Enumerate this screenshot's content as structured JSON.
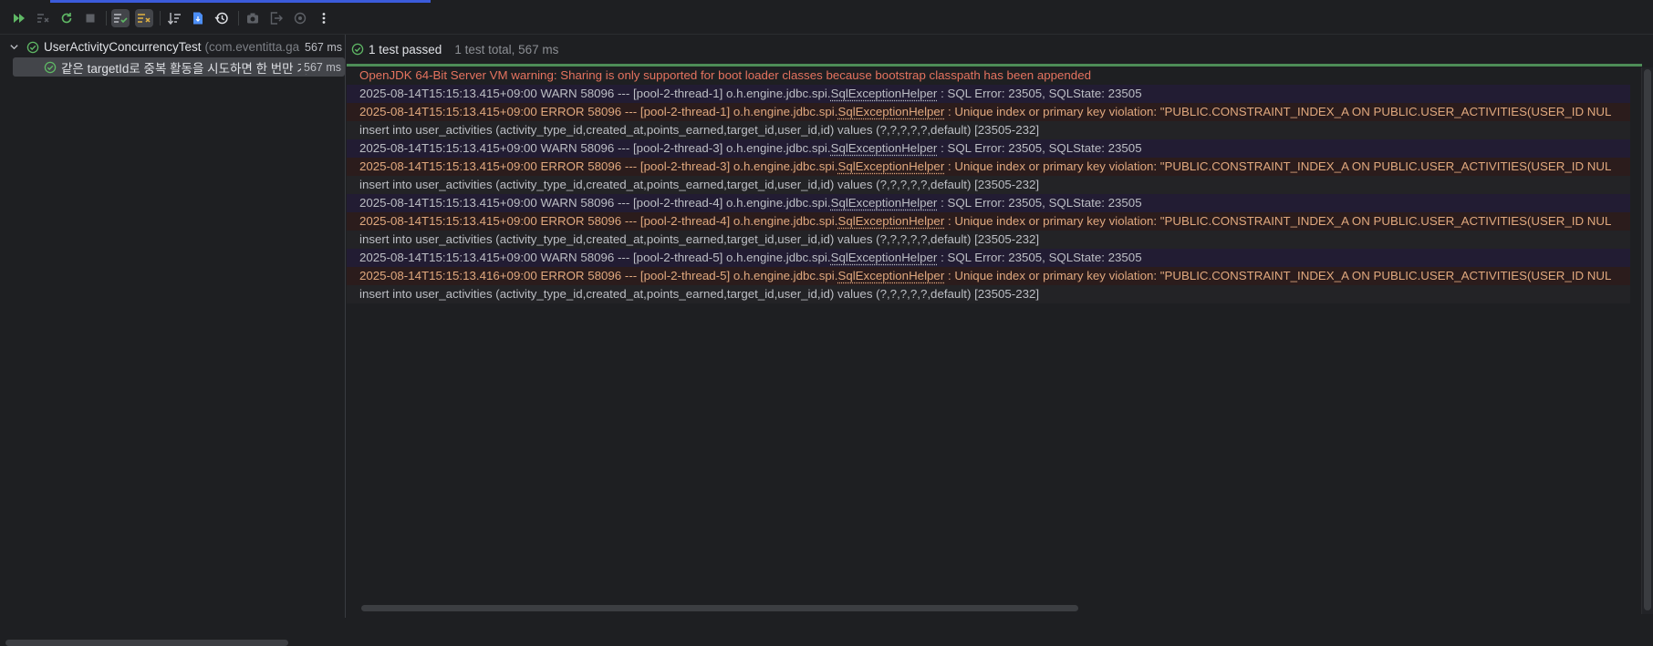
{
  "toolbar": {
    "icons": [
      "rerun-icon",
      "rerun-failed-icon",
      "toggle-auto-test-icon",
      "stop-icon",
      "show-passed-icon",
      "show-ignored-icon",
      "sort-icon",
      "import-tests-icon",
      "history-icon",
      "screenshot-icon",
      "export-icon",
      "settings-icon",
      "more-icon"
    ]
  },
  "tree": {
    "root": {
      "name": "UserActivityConcurrencyTest",
      "package": "(com.eventitta.ga",
      "time": "567 ms"
    },
    "child": {
      "name": "같은 targetId로 중복 활동을 시도하면 한 번만 기록",
      "time": "567 ms"
    }
  },
  "status": {
    "passed": "1 test passed",
    "total": "1 test total, 567 ms"
  },
  "console": [
    {
      "type": "jvm",
      "text": "OpenJDK 64-Bit Server VM warning: Sharing is only supported for boot loader classes because bootstrap classpath has been appended"
    },
    {
      "type": "warn",
      "pre": "2025-08-14T15:15:13.415+09:00  WARN 58096 --- [pool-2-thread-1] o.h.engine.jdbc.spi.",
      "cls": "SqlExceptionHelper",
      "post": "   : SQL Error: 23505, SQLState: 23505"
    },
    {
      "type": "err",
      "pre": "2025-08-14T15:15:13.415+09:00 ERROR 58096 --- [pool-2-thread-1] o.h.engine.jdbc.spi.",
      "cls": "SqlExceptionHelper",
      "post": "   : Unique index or primary key violation: \"PUBLIC.CONSTRAINT_INDEX_A ON PUBLIC.USER_ACTIVITIES(USER_ID NUL"
    },
    {
      "type": "plain",
      "text": "insert into user_activities (activity_type_id,created_at,points_earned,target_id,user_id,id) values (?,?,?,?,?,default) [23505-232]"
    },
    {
      "type": "warn",
      "pre": "2025-08-14T15:15:13.415+09:00  WARN 58096 --- [pool-2-thread-3] o.h.engine.jdbc.spi.",
      "cls": "SqlExceptionHelper",
      "post": "   : SQL Error: 23505, SQLState: 23505"
    },
    {
      "type": "err",
      "pre": "2025-08-14T15:15:13.415+09:00 ERROR 58096 --- [pool-2-thread-3] o.h.engine.jdbc.spi.",
      "cls": "SqlExceptionHelper",
      "post": "   : Unique index or primary key violation: \"PUBLIC.CONSTRAINT_INDEX_A ON PUBLIC.USER_ACTIVITIES(USER_ID NUL"
    },
    {
      "type": "plain",
      "text": "insert into user_activities (activity_type_id,created_at,points_earned,target_id,user_id,id) values (?,?,?,?,?,default) [23505-232]"
    },
    {
      "type": "warn",
      "pre": "2025-08-14T15:15:13.415+09:00  WARN 58096 --- [pool-2-thread-4] o.h.engine.jdbc.spi.",
      "cls": "SqlExceptionHelper",
      "post": "   : SQL Error: 23505, SQLState: 23505"
    },
    {
      "type": "err",
      "pre": "2025-08-14T15:15:13.415+09:00 ERROR 58096 --- [pool-2-thread-4] o.h.engine.jdbc.spi.",
      "cls": "SqlExceptionHelper",
      "post": "   : Unique index or primary key violation: \"PUBLIC.CONSTRAINT_INDEX_A ON PUBLIC.USER_ACTIVITIES(USER_ID NUL"
    },
    {
      "type": "plain",
      "text": "insert into user_activities (activity_type_id,created_at,points_earned,target_id,user_id,id) values (?,?,?,?,?,default) [23505-232]"
    },
    {
      "type": "warn",
      "pre": "2025-08-14T15:15:13.415+09:00  WARN 58096 --- [pool-2-thread-5] o.h.engine.jdbc.spi.",
      "cls": "SqlExceptionHelper",
      "post": "   : SQL Error: 23505, SQLState: 23505"
    },
    {
      "type": "err",
      "pre": "2025-08-14T15:15:13.416+09:00 ERROR 58096 --- [pool-2-thread-5] o.h.engine.jdbc.spi.",
      "cls": "SqlExceptionHelper",
      "post": "   : Unique index or primary key violation: \"PUBLIC.CONSTRAINT_INDEX_A ON PUBLIC.USER_ACTIVITIES(USER_ID NUL"
    },
    {
      "type": "plain",
      "text": "insert into user_activities (activity_type_id,created_at,points_earned,target_id,user_id,id) values (?,?,?,?,?,default) [23505-232]"
    }
  ]
}
